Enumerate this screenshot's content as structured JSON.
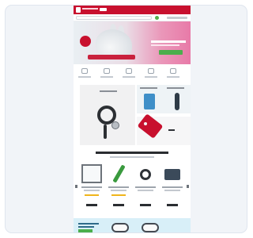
{
  "page": {
    "colors": {
      "brand_red": "#c8102e",
      "cta_green": "#4cae4c",
      "hero_pink": "#e87aa8",
      "promo_blue": "#d8eff8",
      "star_gold": "#f0b51c"
    }
  },
  "header": {
    "logo_icon": "brand-logo-icon",
    "search_icon": "search-icon",
    "cart_icon": "cart-icon"
  },
  "hero": {
    "slide": "rabbit-on-exam-table"
  },
  "usps": [
    {
      "icon": "truck-icon"
    },
    {
      "icon": "shield-icon"
    },
    {
      "icon": "phone-icon"
    },
    {
      "icon": "medal-icon"
    },
    {
      "icon": "return-icon"
    }
  ],
  "categories": [
    {
      "icon": "stethoscope-icon"
    },
    {
      "icon": "monitor-icon"
    },
    {
      "icon": "thermometer-icon"
    },
    {
      "icon": "price-tag-icon"
    },
    {
      "icon": "clipper-icon"
    }
  ],
  "bestsellers": {
    "products": [
      {
        "icon": "x-ray-viewer-icon",
        "rating": 5
      },
      {
        "icon": "syringe-icon",
        "rating": 5
      },
      {
        "icon": "pulse-oximeter-icon",
        "rating": 0
      },
      {
        "icon": "infusion-pump-icon",
        "rating": 0
      }
    ]
  },
  "promo": {
    "devices": [
      "blood-pressure-cuff-icon",
      "stethoscope-icon"
    ]
  }
}
